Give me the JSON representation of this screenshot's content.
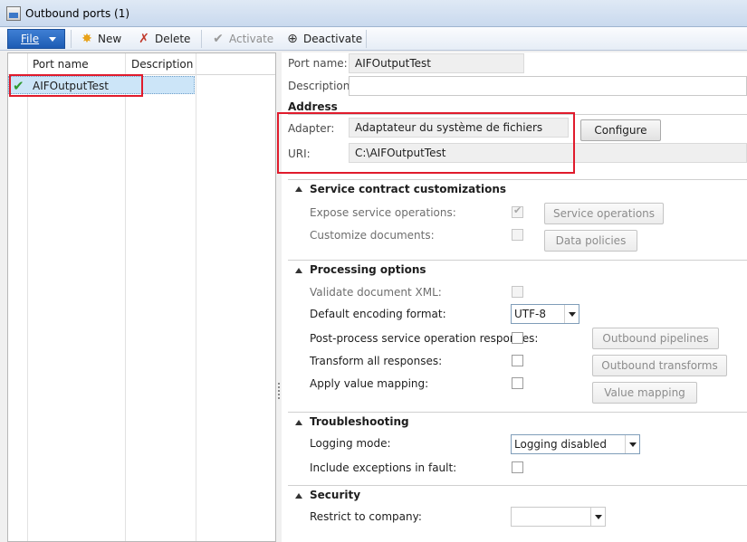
{
  "window": {
    "title": "Outbound ports (1)"
  },
  "toolbar": {
    "file_label": "File",
    "new_label": "New",
    "delete_label": "Delete",
    "activate_label": "Activate",
    "deactivate_label": "Deactivate"
  },
  "grid": {
    "columns": [
      "Port name",
      "Description"
    ],
    "rows": [
      {
        "port_name": "AIFOutputTest",
        "description": "",
        "active": true
      }
    ]
  },
  "details": {
    "port_name_label": "Port name:",
    "port_name_value": "AIFOutputTest",
    "description_label": "Description:",
    "description_value": "",
    "address_title": "Address",
    "adapter_label": "Adapter:",
    "adapter_value": "Adaptateur du système de fichiers",
    "configure_label": "Configure",
    "uri_label": "URI:",
    "uri_value": "C:\\AIFOutputTest"
  },
  "service_contract": {
    "title": "Service contract customizations",
    "expose_label": "Expose service operations:",
    "expose_checked": true,
    "customize_label": "Customize documents:",
    "customize_checked": false,
    "service_operations_button": "Service operations",
    "data_policies_button": "Data policies"
  },
  "processing": {
    "title": "Processing options",
    "validate_label": "Validate document XML:",
    "encoding_label": "Default encoding format:",
    "encoding_value": "UTF-8",
    "postprocess_label": "Post-process service operation responses:",
    "transform_label": "Transform all responses:",
    "value_mapping_label": "Apply value mapping:",
    "outbound_pipelines_button": "Outbound pipelines",
    "outbound_transforms_button": "Outbound transforms",
    "value_mapping_button": "Value mapping"
  },
  "troubleshooting": {
    "title": "Troubleshooting",
    "logging_label": "Logging mode:",
    "logging_value": "Logging disabled",
    "exceptions_label": "Include exceptions in fault:"
  },
  "security": {
    "title": "Security",
    "restrict_label": "Restrict to company:",
    "restrict_value": ""
  },
  "colors": {
    "highlight_box": "#e01b2c",
    "selection": "#cce5f8",
    "file_button": "#1d5cb4"
  }
}
